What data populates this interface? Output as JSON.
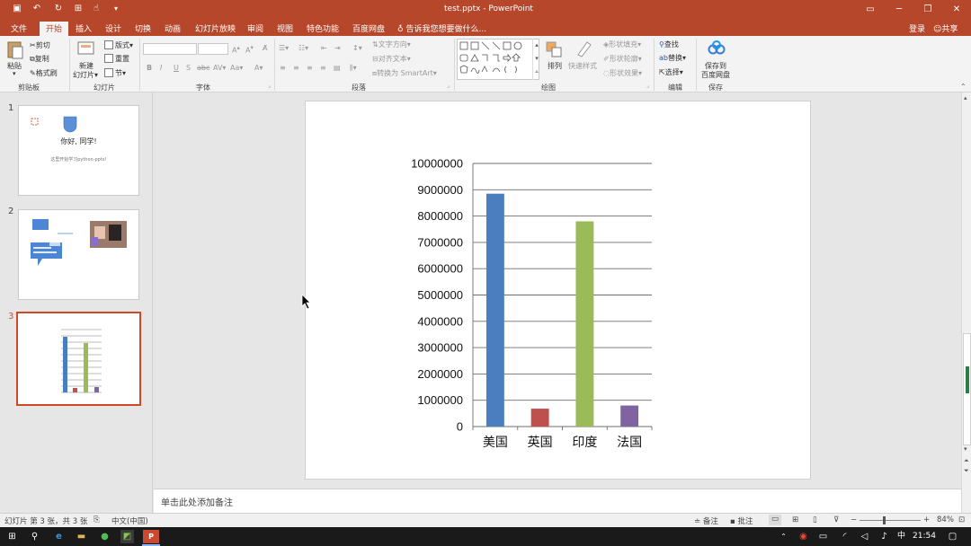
{
  "window": {
    "title": "test.pptx - PowerPoint",
    "login": "登录",
    "share": "共享"
  },
  "tabs": [
    {
      "label": "文件"
    },
    {
      "label": "开始",
      "active": true
    },
    {
      "label": "插入"
    },
    {
      "label": "设计"
    },
    {
      "label": "切换"
    },
    {
      "label": "动画"
    },
    {
      "label": "幻灯片放映"
    },
    {
      "label": "审阅"
    },
    {
      "label": "视图"
    },
    {
      "label": "特色功能"
    },
    {
      "label": "百度网盘"
    }
  ],
  "tell_me": "告诉我您想要做什么...",
  "ribbon": {
    "clipboard": {
      "paste": "粘贴",
      "cut": "剪切",
      "copy": "复制",
      "format_painter": "格式刷",
      "group": "剪贴板"
    },
    "slides": {
      "new_slide": "新建",
      "new_slide2": "幻灯片",
      "layout": "版式",
      "reset": "重置",
      "section": "节",
      "group": "幻灯片"
    },
    "font": {
      "group": "字体"
    },
    "paragraph": {
      "text_direction": "文字方向",
      "align_text": "对齐文本",
      "smartart": "转换为 SmartArt",
      "group": "段落"
    },
    "drawing": {
      "arrange": "排列",
      "quick_styles": "快速样式",
      "fill": "形状填充",
      "outline": "形状轮廓",
      "effects": "形状效果",
      "group": "绘图"
    },
    "editing": {
      "find": "查找",
      "replace": "替换",
      "select": "选择",
      "group": "编辑"
    },
    "save": {
      "save_to": "保存到",
      "baidu": "百度网盘",
      "group": "保存"
    }
  },
  "thumbnails": [
    {
      "num": "1",
      "title": "你好, 同学!",
      "subtitle": "这里开始学习python-pptx!"
    },
    {
      "num": "2"
    },
    {
      "num": "3",
      "selected": true
    }
  ],
  "notes_placeholder": "单击此处添加备注",
  "status": {
    "slide_info": "幻灯片 第 3 张，共 3 张",
    "language": "中文(中国)",
    "notes": "备注",
    "comments": "批注",
    "zoom": "84%"
  },
  "taskbar": {
    "ime": "中",
    "time": "21:54"
  },
  "colors": {
    "accent": "#b7472a",
    "bar_us": "#4a7ebf",
    "bar_uk": "#c0504d",
    "bar_in": "#9bbb59",
    "bar_fr": "#8064a2"
  },
  "chart_data": {
    "type": "bar",
    "categories": [
      "美国",
      "英国",
      "印度",
      "法国"
    ],
    "values": [
      8850000,
      680000,
      7800000,
      800000
    ],
    "ylim": [
      0,
      10000000
    ],
    "yticks": [
      0,
      1000000,
      2000000,
      3000000,
      4000000,
      5000000,
      6000000,
      7000000,
      8000000,
      9000000,
      10000000
    ],
    "colors": [
      "#4a7ebf",
      "#c0504d",
      "#9bbb59",
      "#8064a2"
    ],
    "grid": true,
    "legend": "none"
  }
}
